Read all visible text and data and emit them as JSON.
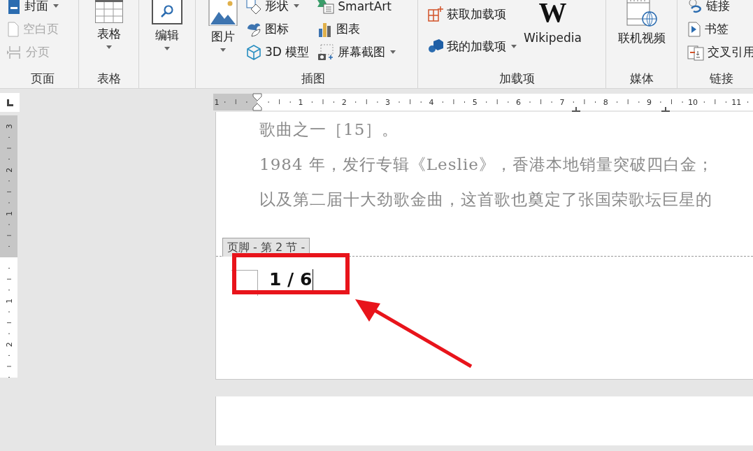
{
  "ribbon": {
    "groups": [
      {
        "label": "页面",
        "items": [
          {
            "kind": "small",
            "label": "封面",
            "dropdown": true,
            "disabled": false
          },
          {
            "kind": "small",
            "label": "空白页",
            "dropdown": false,
            "disabled": true
          },
          {
            "kind": "small",
            "label": "分页",
            "dropdown": false,
            "disabled": true
          }
        ]
      },
      {
        "label": "表格",
        "items": [
          {
            "kind": "large",
            "label": "表格",
            "dropdown": true,
            "disabled": false
          }
        ]
      },
      {
        "items": [
          {
            "kind": "large",
            "label": "编辑",
            "dropdown": true,
            "disabled": false
          }
        ]
      },
      {
        "label": "插图",
        "items": [
          {
            "kind": "large",
            "label": "图片",
            "dropdown": true,
            "disabled": false
          },
          {
            "kind": "small",
            "label": "形状",
            "dropdown": true,
            "disabled": false
          },
          {
            "kind": "small",
            "label": "图标",
            "dropdown": false,
            "disabled": false
          },
          {
            "kind": "small",
            "label": "3D 模型",
            "dropdown": false,
            "disabled": false
          },
          {
            "kind": "small",
            "label": "SmartArt",
            "dropdown": false,
            "disabled": false
          },
          {
            "kind": "small",
            "label": "图表",
            "dropdown": false,
            "disabled": false
          },
          {
            "kind": "small",
            "label": "屏幕截图",
            "dropdown": true,
            "disabled": false
          }
        ]
      },
      {
        "label": "加载项",
        "items": [
          {
            "kind": "small",
            "label": "获取加载项",
            "dropdown": false,
            "disabled": false
          },
          {
            "kind": "small",
            "label": "我的加载项",
            "dropdown": true,
            "disabled": false
          },
          {
            "kind": "large",
            "label": "Wikipedia",
            "glyph": "W",
            "dropdown": false,
            "disabled": false
          }
        ]
      },
      {
        "label": "媒体",
        "items": [
          {
            "kind": "large",
            "label": "联机视频",
            "dropdown": false,
            "disabled": false
          }
        ]
      },
      {
        "label": "链接",
        "items": [
          {
            "kind": "small",
            "label": "链接",
            "dropdown": false,
            "disabled": false
          },
          {
            "kind": "small",
            "label": "书签",
            "dropdown": false,
            "disabled": false
          },
          {
            "kind": "small",
            "label": "交叉引用",
            "dropdown": false,
            "disabled": false
          }
        ]
      }
    ]
  },
  "horizontal_ruler": {
    "labels": [
      "1",
      "1",
      "2",
      "3",
      "4",
      "5",
      "6",
      "7",
      "8",
      "9",
      "10",
      "11"
    ]
  },
  "vertical_ruler": {
    "upper": [
      "3",
      "2",
      "1"
    ],
    "lower": [
      "1",
      "2"
    ]
  },
  "document": {
    "lines": [
      "歌曲之一［15］。",
      "1984 年，发行专辑《Leslie》，香港本地销量突破四白金；",
      "以及第二届十大劲歌金曲，这首歌也奠定了张国荣歌坛巨星的"
    ],
    "footer_tag": "页脚 - 第 2 节 -",
    "page_number": "1 / 6"
  }
}
